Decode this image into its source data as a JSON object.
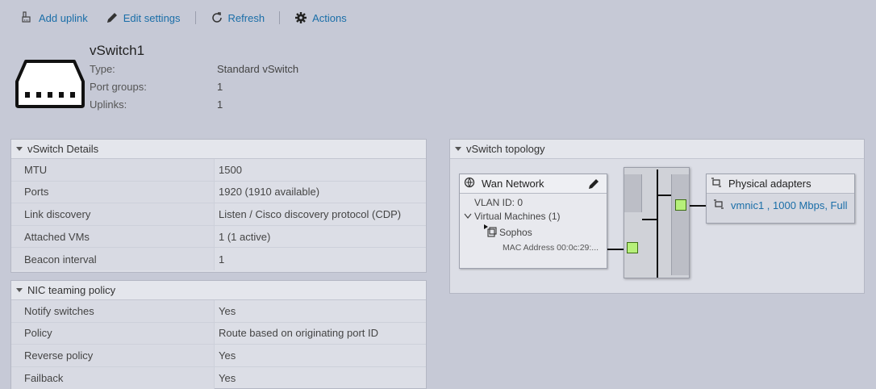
{
  "toolbar": {
    "add_uplink": "Add uplink",
    "edit_settings": "Edit settings",
    "refresh": "Refresh",
    "actions": "Actions"
  },
  "header": {
    "title": "vSwitch1",
    "props": [
      {
        "key": "Type:",
        "value": "Standard vSwitch"
      },
      {
        "key": "Port groups:",
        "value": "1"
      },
      {
        "key": "Uplinks:",
        "value": "1"
      }
    ]
  },
  "details": {
    "title": "vSwitch Details",
    "rows": [
      {
        "key": "MTU",
        "value": "1500"
      },
      {
        "key": "Ports",
        "value": "1920 (1910 available)"
      },
      {
        "key": "Link discovery",
        "value": "Listen / Cisco discovery protocol (CDP)"
      },
      {
        "key": "Attached VMs",
        "value": "1 (1 active)"
      },
      {
        "key": "Beacon interval",
        "value": "1"
      }
    ]
  },
  "nic": {
    "title": "NIC teaming policy",
    "rows": [
      {
        "key": "Notify switches",
        "value": "Yes"
      },
      {
        "key": "Policy",
        "value": "Route based on originating port ID"
      },
      {
        "key": "Reverse policy",
        "value": "Yes"
      },
      {
        "key": "Failback",
        "value": "Yes"
      }
    ]
  },
  "topology": {
    "title": "vSwitch topology",
    "portgroup": {
      "name": "Wan Network",
      "vlan": "VLAN ID: 0",
      "vms": "Virtual Machines (1)",
      "vm_name": "Sophos",
      "mac": "MAC Address 00:0c:29:..."
    },
    "adapters": {
      "title": "Physical adapters",
      "item": "vmnic1 , 1000 Mbps, Full"
    }
  },
  "colors": {
    "link": "#1a6ea8",
    "background": "#c6c9d6",
    "port_green": "#b6f07a"
  }
}
